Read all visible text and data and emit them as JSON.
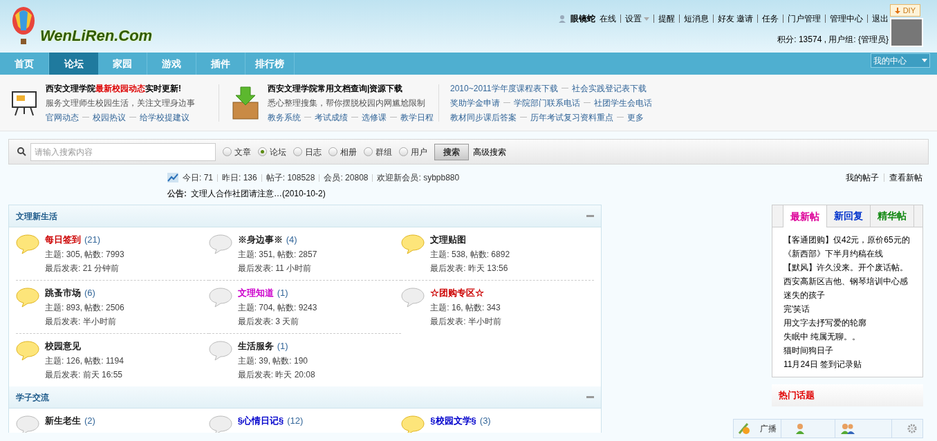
{
  "header": {
    "logo": "WenLiRen.Com",
    "diy": "DIY",
    "user": {
      "name": "眼镜蛇",
      "status": "在线"
    },
    "links": [
      {
        "label": "设置",
        "dropdown": true
      },
      {
        "label": "提醒",
        "dropdown": false
      },
      {
        "label": "短消息",
        "dropdown": false
      },
      {
        "label": "好友 邀请",
        "dropdown": false
      },
      {
        "label": "任务",
        "dropdown": false
      },
      {
        "label": "门户管理",
        "dropdown": false
      },
      {
        "label": "管理中心",
        "dropdown": false
      },
      {
        "label": "退出",
        "dropdown": false
      }
    ],
    "credits": "积分: 13574 , 用户组: {管理员}"
  },
  "nav": {
    "tabs": [
      {
        "label": "首页",
        "selected": false
      },
      {
        "label": "论坛",
        "selected": true
      },
      {
        "label": "家园",
        "selected": false
      },
      {
        "label": "游戏",
        "selected": false
      },
      {
        "label": "插件",
        "selected": false
      },
      {
        "label": "排行榜",
        "selected": false
      }
    ],
    "my_center": "我的中心"
  },
  "promo": [
    {
      "kind": "board",
      "title": "西安文理学院**最新校园动态**实时更新!",
      "subtitle": "服务文理师生校园生活，关注文理身边事",
      "links": [
        "官网动态",
        "校园热议",
        "给学校提建议"
      ]
    },
    {
      "kind": "box",
      "title": "西安文理学院常用文档查询|资源下载",
      "subtitle": "悉心整理搜集，帮你摆脱校园内网尴尬限制",
      "links": [
        "教务系统",
        "考试成绩",
        "选修课",
        "教学日程"
      ]
    },
    {
      "kind": "links",
      "rows": [
        [
          "2010~2011学年度课程表下载",
          "社会实践登记表下载"
        ],
        [
          "奖助学金申请",
          "学院部门联系电话",
          "社团学生会电话"
        ],
        [
          "教材同步课后答案",
          "历年考试复习资料重点",
          "更多"
        ]
      ]
    }
  ],
  "search": {
    "placeholder": "请输入搜索内容",
    "options": [
      {
        "label": "文章",
        "selected": false
      },
      {
        "label": "论坛",
        "selected": true
      },
      {
        "label": "日志",
        "selected": false
      },
      {
        "label": "相册",
        "selected": false
      },
      {
        "label": "群组",
        "selected": false
      },
      {
        "label": "用户",
        "selected": false
      }
    ],
    "button": "搜索",
    "advanced": "高级搜索"
  },
  "stats": [
    "今日: 71",
    "昨日: 136",
    "帖子: 108528",
    "会员: 20808",
    "欢迎新会员: sybpb880"
  ],
  "quick_links": [
    "我的帖子",
    "查看新帖"
  ],
  "notice": {
    "label": "公告:",
    "items": [
      "文理人合作社团请注意…(2010-10-2)"
    ]
  },
  "categories": [
    {
      "title": "文理新生活",
      "boards": [
        {
          "name": "每日签到",
          "color": "#cc0000",
          "today": "(21)",
          "new": true,
          "counts": "主题: 305, 帖数: 7993",
          "last": "最后发表: 21 分钟前"
        },
        {
          "name": "※身边事※",
          "color": "#222222",
          "today": "(4)",
          "new": false,
          "counts": "主题: 351, 帖数: 2857",
          "last": "最后发表: 11 小时前"
        },
        {
          "name": "文理贴图",
          "color": "#222222",
          "new": true,
          "counts": "主题: 538, 帖数: 6892",
          "last": "最后发表: 昨天 13:56"
        },
        {
          "name": "跳蚤市场",
          "color": "#222222",
          "today": "(6)",
          "new": true,
          "counts": "主题: 893, 帖数: 2506",
          "last": "最后发表: 半小时前"
        },
        {
          "name": "文理知道",
          "color": "#cc00cc",
          "today": "(1)",
          "new": false,
          "counts": "主题: 704, 帖数: 9243",
          "last": "最后发表: 3 天前"
        },
        {
          "name": "☆团购专区☆",
          "color": "#cc0000",
          "new": false,
          "counts": "主题: 16, 帖数: 343",
          "last": "最后发表: 半小时前"
        },
        {
          "name": "校园意见",
          "color": "#222222",
          "new": true,
          "counts": "主题: 126, 帖数: 1194",
          "last": "最后发表: 前天 16:55"
        },
        {
          "name": "生活服务",
          "color": "#222222",
          "today": "(1)",
          "new": false,
          "counts": "主题: 39, 帖数: 190",
          "last": "最后发表: 昨天 20:08"
        }
      ]
    },
    {
      "title": "学子交流",
      "boards": [
        {
          "name": "新生老生",
          "color": "#222222",
          "today": "(2)",
          "new": false
        },
        {
          "name": "§心情日记§",
          "color": "#0000cc",
          "today": "(12)",
          "new": false
        },
        {
          "name": "§校园文学§",
          "color": "#0000cc",
          "today": "(3)",
          "new": true
        }
      ]
    }
  ],
  "sidebar": {
    "tabs": [
      {
        "label": "最新帖",
        "selected": true,
        "color": "#dd0099"
      },
      {
        "label": "新回复",
        "selected": false,
        "color": "#0033cc"
      },
      {
        "label": "精华帖",
        "selected": false,
        "color": "#118811"
      }
    ],
    "posts": [
      "【客通团购】仅42元，原价65元的",
      "《新西部》下半月约稿在线",
      "【默风】许久没来。开个废话帖。",
      "西安高新区吉他、钢琴培训中心感",
      "迷失的孩子",
      "完'笑话",
      "用文字去抒写爱的轮廓",
      "失眠中 纯属无聊。。",
      "猫时间狗日子",
      "11月24日 签到记录贴"
    ],
    "hot_title": "热门话题"
  },
  "chat_bar": {
    "broadcast": "广播"
  }
}
